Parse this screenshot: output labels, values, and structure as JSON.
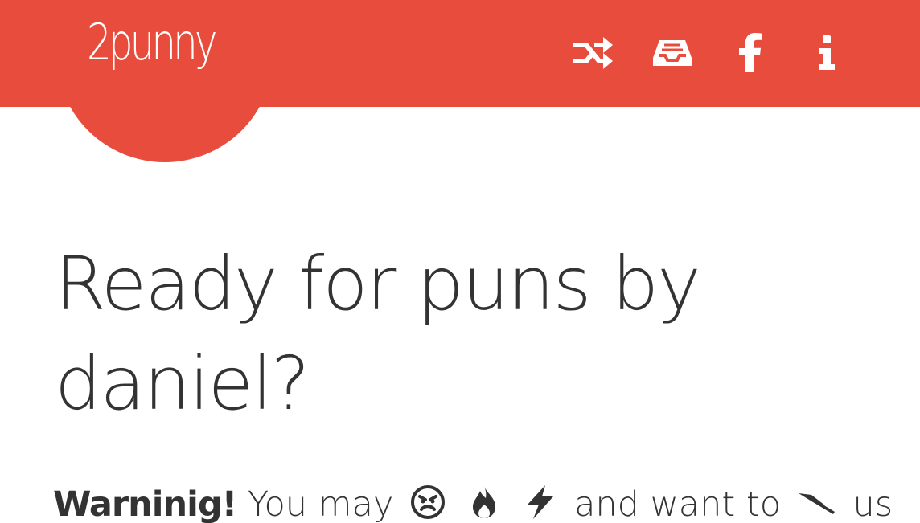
{
  "brand": {
    "name": "2punny",
    "accent_color": "#e74c3c",
    "text_color": "#333333"
  },
  "nav": {
    "items": [
      {
        "icon": "shuffle-icon"
      },
      {
        "icon": "inbox-tray-icon"
      },
      {
        "icon": "facebook-icon"
      },
      {
        "icon": "info-icon"
      }
    ]
  },
  "hero": {
    "title": "Ready for puns by daniel?",
    "warning_label": "Warninig!",
    "warning_text_1": "You may",
    "warning_text_2": "and want to",
    "warning_text_3": "us",
    "warning_icons": [
      "angry-face-icon",
      "fire-icon",
      "lightning-icon",
      "knife-icon"
    ]
  }
}
